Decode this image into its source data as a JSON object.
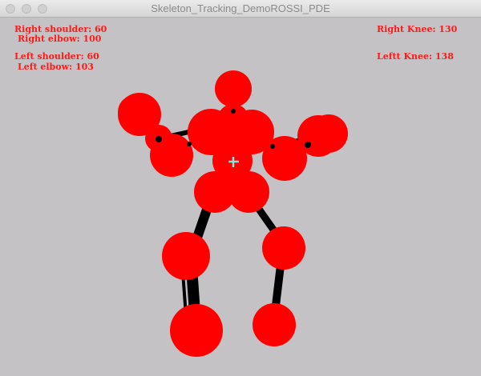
{
  "window": {
    "title": "Skeleton_Tracking_DemoROSSI_PDE"
  },
  "readouts": {
    "right_shoulder": "Right shoulder: 60",
    "right_elbow": "Right elbow: 100",
    "left_shoulder": "Left shoulder: 60",
    "left_elbow": "Left elbow: 103",
    "right_knee": "Right Knee: 130",
    "left_knee": "Leftt Knee: 138"
  },
  "colors": {
    "background": "#c4c2c4",
    "joint": "#ff0000",
    "bone": "#000000",
    "cursor": "#7fe6e0",
    "text": "#ff1a1a"
  }
}
